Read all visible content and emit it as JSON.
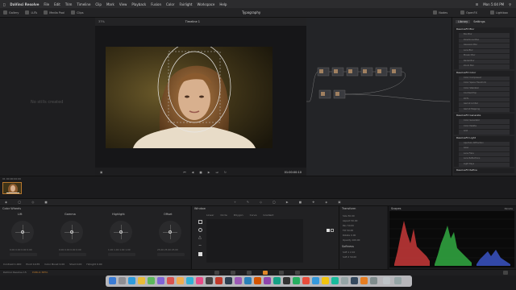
{
  "menubar": {
    "app": "DaVinci Resolve",
    "items": [
      "File",
      "Edit",
      "Trim",
      "Timeline",
      "Clip",
      "Mark",
      "View",
      "Playback",
      "Fusion",
      "Color",
      "Fairlight",
      "Workspace",
      "Help"
    ],
    "clock": "Mon 5:04 PM"
  },
  "toolbar": {
    "left": [
      "Gallery",
      "LUTs",
      "Media Pool",
      "Clips"
    ],
    "project": "Typography",
    "right": [
      "Nodes",
      "OpenFX",
      "Lightbox"
    ]
  },
  "viewer": {
    "title": "Timeline 1",
    "timecode": "01:00:00:10",
    "zoom": "37%"
  },
  "gallery": {
    "empty_message": "No stills created"
  },
  "openfx": {
    "tabs": [
      "Library",
      "Settings"
    ],
    "sections": [
      {
        "title": "ResolveFX Blur",
        "items": [
          "Box Blur",
          "Directional Blur",
          "Gaussian Blur",
          "Lens Blur",
          "Mosaic Blur",
          "Radial Blur",
          "Zoom Blur"
        ]
      },
      {
        "title": "ResolveFX Color",
        "items": [
          "Color Compressor",
          "Color Space Transform",
          "Color Stabilizer",
          "Contrast Pop",
          "DCTL",
          "Gamut Limiter",
          "Gamut Mapping"
        ]
      },
      {
        "title": "ResolveFX Generate",
        "items": [
          "Color Generator",
          "Color Palette",
          "Grid"
        ]
      },
      {
        "title": "ResolveFX Light",
        "items": [
          "Aperture Diffraction",
          "Glow",
          "Lens Flare",
          "Lens Reflections",
          "Light Rays"
        ]
      },
      {
        "title": "ResolveFX Refine",
        "items": []
      }
    ]
  },
  "clip": {
    "label": "01  00:00:00:00"
  },
  "color_wheels": {
    "panel_title": "Color Wheels",
    "wheels": [
      {
        "label": "Lift",
        "values": "0.00  0.00  0.00  0.00"
      },
      {
        "label": "Gamma",
        "values": "0.00  0.00  0.00  0.00"
      },
      {
        "label": "Highlight",
        "values": "1.00  1.00  1.00  1.00"
      },
      {
        "label": "Offset",
        "values": "25.00  25.00  25.00"
      }
    ],
    "params": [
      "Contrast 1.000",
      "Pivot 0.435",
      "Color Boost 0.00",
      "Shad 0.00",
      "Hi/Light 0.00"
    ]
  },
  "window_panel": {
    "title": "Window",
    "tabs": [
      "Linear",
      "Circle",
      "Polygon",
      "Curve",
      "Gradient"
    ],
    "transform_title": "Transform",
    "softness_title": "Softness",
    "transform_rows": [
      "Size 50.00",
      "Aspect 50.00",
      "Pan 50.00",
      "Tilt 50.00",
      "Rotate 0.00",
      "Opacity 100.00"
    ],
    "softness_rows": [
      "Soft 1 2.10",
      "Soft 2 50.00"
    ]
  },
  "scopes": {
    "title": "Scopes",
    "mode": "Parade"
  },
  "status": {
    "left": "DaVinci Resolve 15",
    "beta": "PUBLIC BETA"
  },
  "colors": {
    "accent": "#e0872a",
    "panel": "#212123",
    "parade_red": "#d23b3b",
    "parade_green": "#33b445",
    "parade_blue": "#3c57d0"
  }
}
